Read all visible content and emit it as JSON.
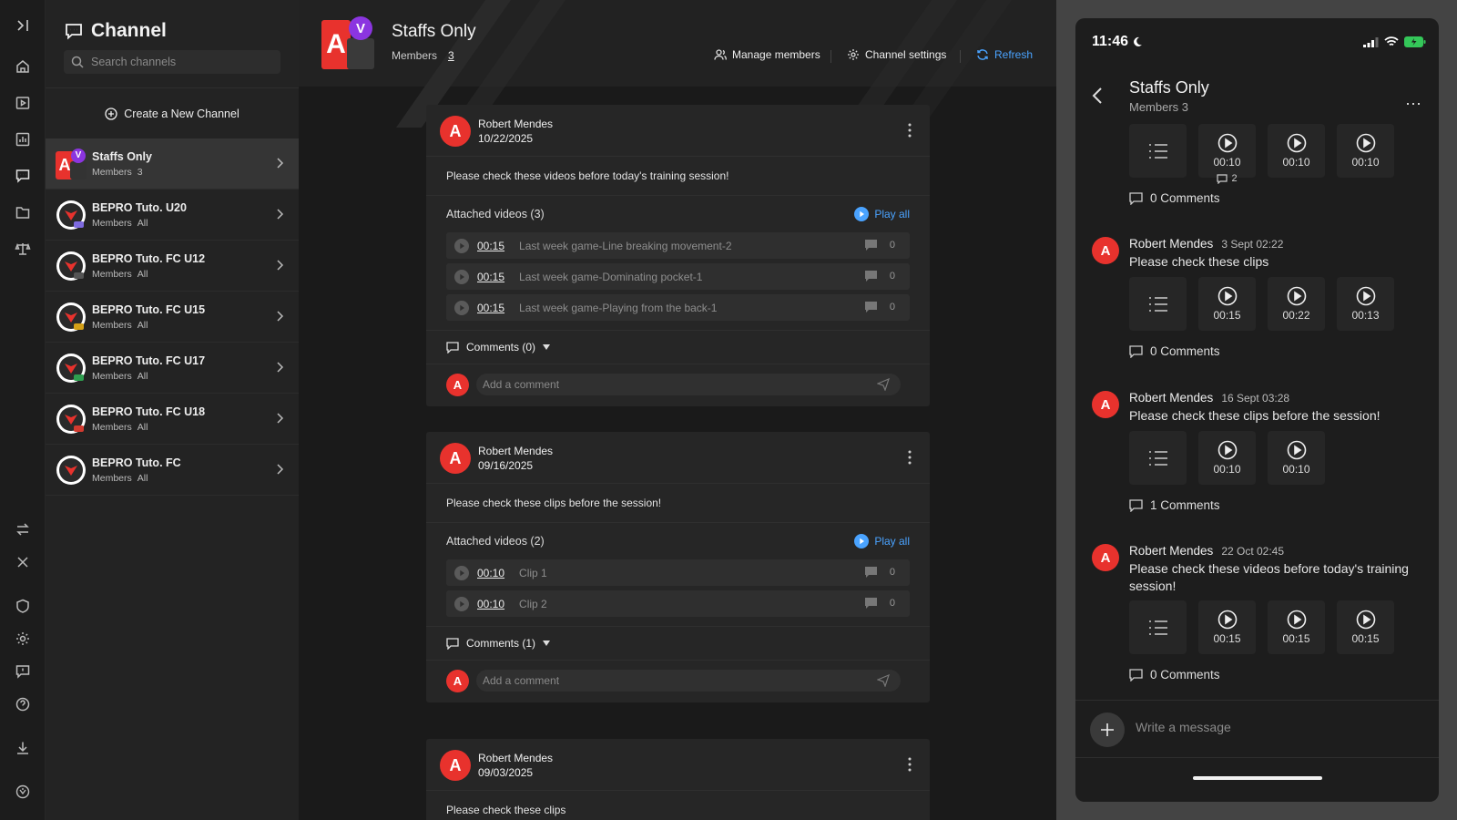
{
  "sidebar": {
    "title": "Channel",
    "search_placeholder": "Search channels",
    "create_label": "Create a New Channel",
    "channels": [
      {
        "name": "Staffs Only",
        "members_label": "Members",
        "members_value": "3",
        "active": true,
        "badge_color": "#8b35e0"
      },
      {
        "name": "BEPRO Tuto. U20",
        "members_label": "Members",
        "members_value": "All",
        "badge_color": "#7e6adf"
      },
      {
        "name": "BEPRO Tuto. FC U12",
        "members_label": "Members",
        "members_value": "All",
        "badge_color": "#555555"
      },
      {
        "name": "BEPRO Tuto. FC U15",
        "members_label": "Members",
        "members_value": "All",
        "badge_color": "#d4a017"
      },
      {
        "name": "BEPRO Tuto. FC U17",
        "members_label": "Members",
        "members_value": "All",
        "badge_color": "#2e9e4f"
      },
      {
        "name": "BEPRO Tuto. FC U18",
        "members_label": "Members",
        "members_value": "All",
        "badge_color": "#d23a2f"
      },
      {
        "name": "BEPRO Tuto. FC",
        "members_label": "Members",
        "members_value": "All",
        "badge_color": ""
      }
    ]
  },
  "header": {
    "title": "Staffs Only",
    "members_label": "Members",
    "members_count": "3",
    "manage_members": "Manage members",
    "channel_settings": "Channel settings",
    "refresh": "Refresh"
  },
  "posts": [
    {
      "avatar": "A",
      "author": "Robert Mendes",
      "date": "10/22/2025",
      "text": "Please check these videos before today's training session!",
      "attached_label": "Attached videos (3)",
      "play_all": "Play all",
      "videos": [
        {
          "duration": "00:15",
          "name": "Last week game-Line breaking movement-2",
          "comments": "0"
        },
        {
          "duration": "00:15",
          "name": "Last week game-Dominating pocket-1",
          "comments": "0"
        },
        {
          "duration": "00:15",
          "name": "Last week game-Playing from the back-1",
          "comments": "0"
        }
      ],
      "comments_label": "Comments (0)",
      "add_comment_placeholder": "Add a comment"
    },
    {
      "avatar": "A",
      "author": "Robert Mendes",
      "date": "09/16/2025",
      "text": "Please check these clips before the session!",
      "attached_label": "Attached videos (2)",
      "play_all": "Play all",
      "videos": [
        {
          "duration": "00:10",
          "name": "Clip 1",
          "comments": "0"
        },
        {
          "duration": "00:10",
          "name": "Clip 2",
          "comments": "0"
        }
      ],
      "comments_label": "Comments (1)",
      "add_comment_placeholder": "Add a comment"
    },
    {
      "avatar": "A",
      "author": "Robert Mendes",
      "date": "09/03/2025",
      "text": "Please check these clips"
    }
  ],
  "phone": {
    "time": "11:46",
    "title": "Staffs Only",
    "members": "Members 3",
    "messages": [
      {
        "thumbs": [
          "00:10",
          "00:10",
          "00:10"
        ],
        "thumb_comment": "2",
        "comments": "0 Comments"
      },
      {
        "author": "Robert Mendes",
        "date": "3 Sept 02:22",
        "text": "Please check these clips",
        "thumbs": [
          "00:15",
          "00:22",
          "00:13"
        ],
        "comments": "0 Comments"
      },
      {
        "author": "Robert Mendes",
        "date": "16 Sept 03:28",
        "text": "Please check these clips before the session!",
        "thumbs": [
          "00:10",
          "00:10"
        ],
        "comments": "1 Comments"
      },
      {
        "author": "Robert Mendes",
        "date": "22 Oct 02:45",
        "text": "Please check these videos before today's training session!",
        "thumbs": [
          "00:15",
          "00:15",
          "00:15"
        ],
        "comments": "0 Comments"
      }
    ],
    "composer_placeholder": "Write a message"
  },
  "colors": {
    "accent_red": "#e8322d",
    "accent_blue": "#4aa3ff",
    "accent_purple": "#8b35e0"
  }
}
